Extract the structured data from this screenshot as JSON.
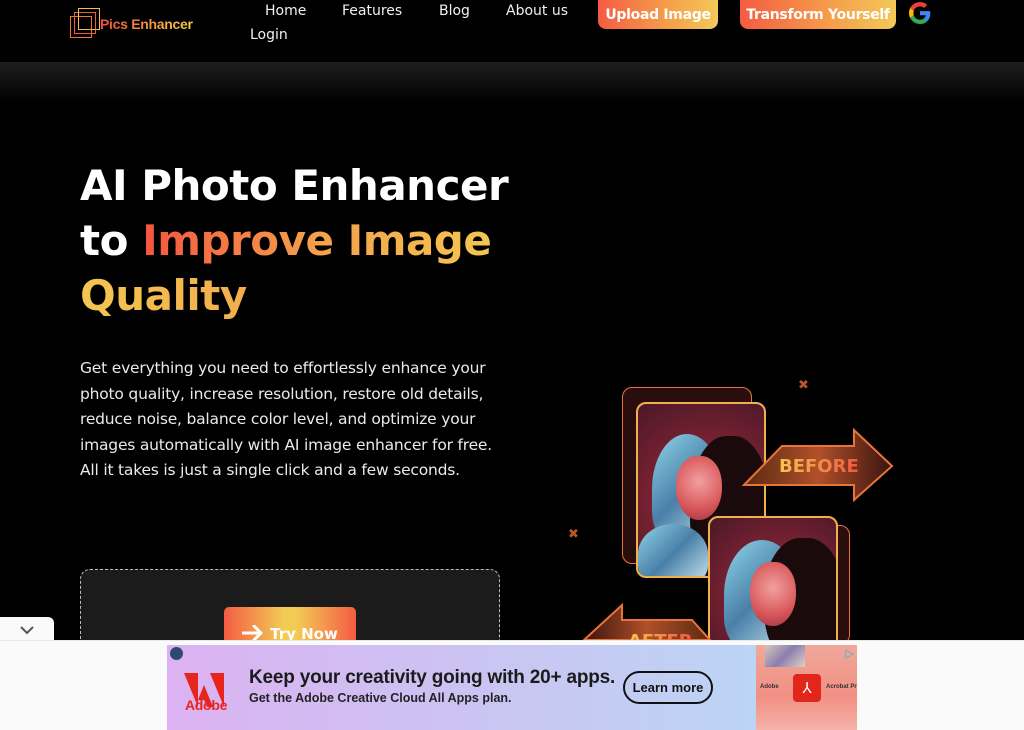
{
  "header": {
    "brand": "Pics Enhancer",
    "nav": [
      {
        "label": "Home"
      },
      {
        "label": "Features"
      },
      {
        "label": "Blog"
      },
      {
        "label": "About us"
      },
      {
        "label": "Login"
      }
    ],
    "upload_button": "Upload Image",
    "transform_button": "Transform Yourself",
    "google_icon": "google-icon"
  },
  "hero": {
    "title_line1": "AI Photo Enhancer",
    "title_line2_prefix": "to ",
    "title_line2_accent": "Improve Image",
    "title_line3_accent": "Quality",
    "description": "Get everything you need to effortlessly enhance your photo quality, increase resolution, restore old details, reduce noise, balance color level, and optimize your images automatically with AI image enhancer for free. All it takes is just a single click and a few seconds.",
    "try_button": "Try Now",
    "try_icon": "arrow-right-icon",
    "colors": {
      "accent_start": "#f4553f",
      "accent_end": "#f3c652"
    }
  },
  "illustration": {
    "before_label": "BEFORE",
    "after_label": "AFTER"
  },
  "ad": {
    "brand": "Adobe",
    "headline": "Keep your creativity going with 20+ apps.",
    "subline": "Get the Adobe Creative Cloud All Apps plan.",
    "cta": "Learn more",
    "visual_left_label": "Adobe",
    "visual_right_label": "Acrobat Pro"
  },
  "collapse_icon": "chevron-down-icon"
}
